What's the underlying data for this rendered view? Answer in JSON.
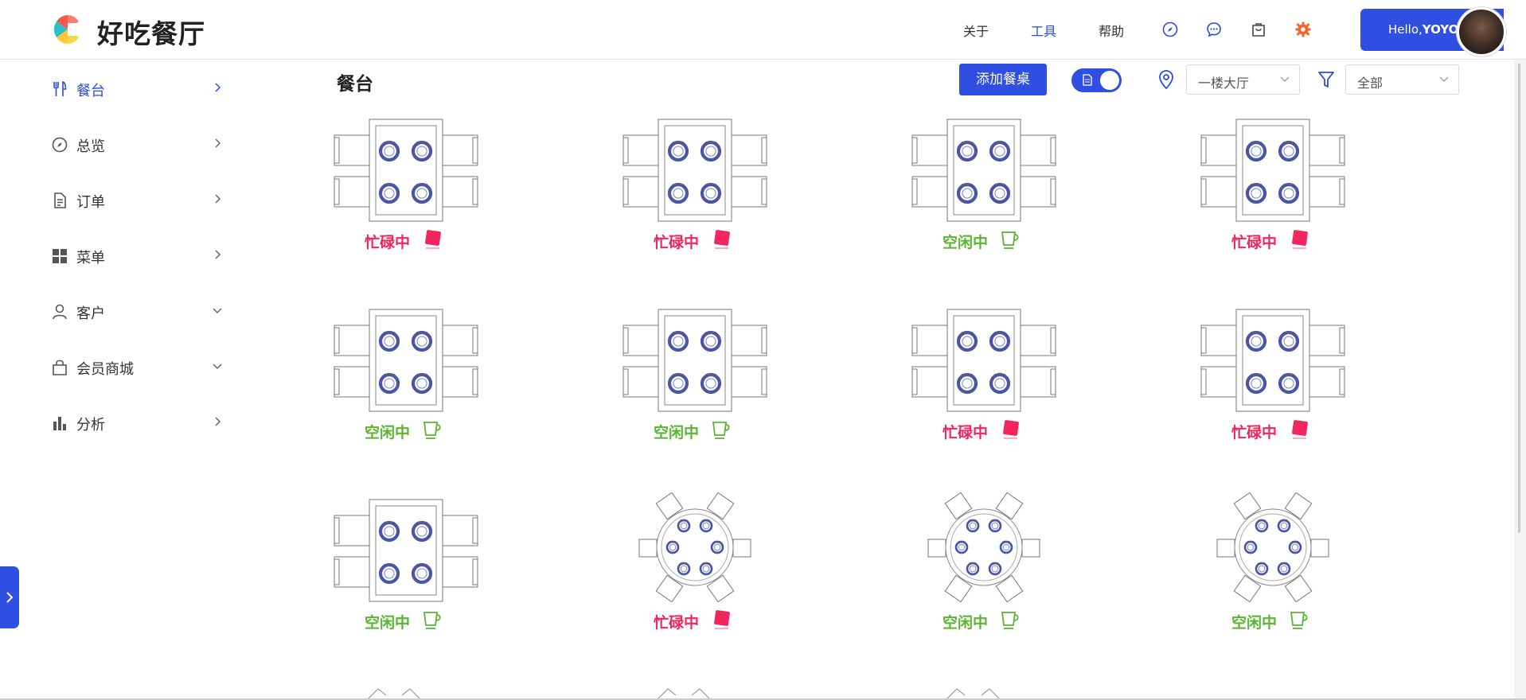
{
  "header": {
    "app_title": "好吃餐厅",
    "nav": [
      "关于",
      "工具",
      "帮助"
    ],
    "active_nav": "工具",
    "icons": [
      "compass-icon",
      "chat-icon",
      "bag-icon",
      "settings-gear-icon"
    ],
    "greeting": "Hello,",
    "username": "YOYO"
  },
  "sidebar": {
    "items": [
      {
        "label": "餐台",
        "icon": "fork-knife-icon",
        "active": true,
        "chevron": "right"
      },
      {
        "label": "总览",
        "icon": "compass-icon",
        "active": false,
        "chevron": "right"
      },
      {
        "label": "订单",
        "icon": "document-icon",
        "active": false,
        "chevron": "right"
      },
      {
        "label": "菜单",
        "icon": "grid-icon",
        "active": false,
        "chevron": "right"
      },
      {
        "label": "客户",
        "icon": "user-icon",
        "active": false,
        "chevron": "down"
      },
      {
        "label": "会员商城",
        "icon": "shopping-bag-icon",
        "active": false,
        "chevron": "down"
      },
      {
        "label": "分析",
        "icon": "bar-chart-icon",
        "active": false,
        "chevron": "right"
      }
    ]
  },
  "toolbar": {
    "page_title": "餐台",
    "add_button": "添加餐桌",
    "toggle_on": true,
    "location_select": "一楼大厅",
    "filter_select": "全部"
  },
  "status_labels": {
    "busy": "忙碌中",
    "free": "空闲中"
  },
  "tables": [
    {
      "shape": "rect",
      "status": "busy"
    },
    {
      "shape": "rect",
      "status": "busy"
    },
    {
      "shape": "rect",
      "status": "free"
    },
    {
      "shape": "rect",
      "status": "busy"
    },
    {
      "shape": "rect",
      "status": "free"
    },
    {
      "shape": "rect",
      "status": "free"
    },
    {
      "shape": "rect",
      "status": "busy"
    },
    {
      "shape": "rect",
      "status": "busy"
    },
    {
      "shape": "rect",
      "status": "free"
    },
    {
      "shape": "round",
      "status": "busy"
    },
    {
      "shape": "round",
      "status": "free"
    },
    {
      "shape": "round",
      "status": "free"
    }
  ],
  "colors": {
    "accent": "#2f4fe3",
    "busy": "#f2255f",
    "free": "#5ab532",
    "plate": "#4a55a8"
  }
}
